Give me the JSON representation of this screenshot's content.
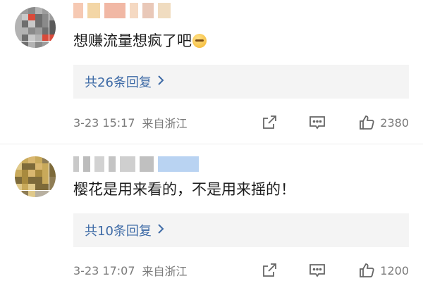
{
  "comments": [
    {
      "content": "想赚流量想疯了吧",
      "replies_label": "共26条回复",
      "time": "3-23 15:17",
      "location": "来自浙江",
      "likes": "2380"
    },
    {
      "content": "樱花是用来看的，不是用来摇的！",
      "replies_label": "共10条回复",
      "time": "3-23 17:07",
      "location": "来自浙江",
      "likes": "1200"
    }
  ],
  "icons": {
    "share": "share-icon",
    "comment": "comment-icon",
    "like": "thumbs-up-icon",
    "chevron": "chevron-right-icon",
    "emoji": "smirk-emoji-icon"
  },
  "colors": {
    "link_blue": "#3d6aa6",
    "meta_gray": "#7a7a7a",
    "reply_bg": "#f4f4f4"
  }
}
